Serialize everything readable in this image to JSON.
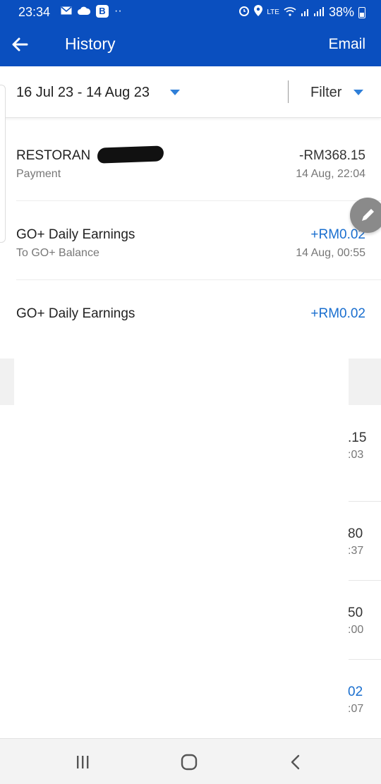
{
  "status_bar": {
    "time": "23:34",
    "b_badge": "B",
    "dots": "··",
    "network": "LTE",
    "battery": "38%",
    "icons": [
      "mail-icon",
      "cloud-icon",
      "alarm-icon",
      "location-icon",
      "wifi-icon",
      "signal-icon",
      "battery-icon"
    ]
  },
  "app_bar": {
    "title": "History",
    "email_label": "Email",
    "back_icon": "arrow-left-icon"
  },
  "filter_bar": {
    "date_range": "16 Jul 23 - 14 Aug 23",
    "filter_label": "Filter"
  },
  "transactions": [
    {
      "name": "RESTORAN",
      "sub": "Payment",
      "amount": "-RM368.15",
      "time": "14 Aug, 22:04",
      "type": "debit"
    },
    {
      "name": "GO+ Daily Earnings",
      "sub": "To GO+ Balance",
      "amount": "+RM0.02",
      "time": "14 Aug, 00:55",
      "type": "credit"
    },
    {
      "name": "GO+ Daily Earnings",
      "sub": "",
      "amount": "+RM0.02",
      "time": "",
      "type": "credit"
    }
  ],
  "partial_rows": [
    {
      "amount": ".15",
      "time": ":03",
      "type": "debit"
    },
    {
      "amount": "80",
      "time": ":37",
      "type": "debit"
    },
    {
      "amount": "50",
      "time": ":00",
      "type": "debit"
    },
    {
      "amount": "02",
      "time": ":07",
      "type": "credit"
    }
  ],
  "colors": {
    "brand": "#0a4fbf",
    "credit": "#1a6fcf",
    "debit": "#333333"
  },
  "nav": {
    "icons": [
      "recent-apps-icon",
      "home-icon",
      "back-icon"
    ]
  }
}
